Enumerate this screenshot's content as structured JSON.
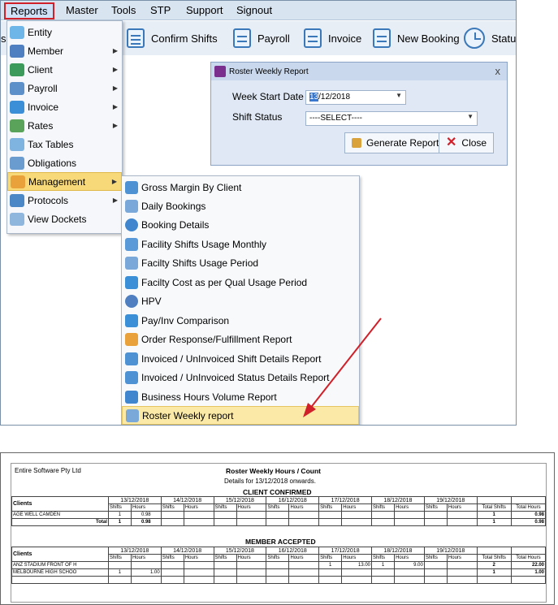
{
  "menubar": {
    "items": [
      "Reports",
      "Master",
      "Tools",
      "STP",
      "Support",
      "Signout"
    ]
  },
  "toolbar": {
    "partial_left": "s",
    "buttons": [
      "Confirm Shifts",
      "Payroll",
      "Invoice",
      "New Booking",
      "Status"
    ]
  },
  "dialog": {
    "title": "Roster Weekly Report",
    "close": "x",
    "week_start_label": "Week Start Date",
    "week_start_day": "13",
    "week_start_rest": "/12/2018",
    "shift_status_label": "Shift Status",
    "shift_status_value": "----SELECT----",
    "generate_label": "Generate Report",
    "close_label": "Close"
  },
  "menu": {
    "items": [
      {
        "label": "Entity",
        "icon": "entity-icon",
        "submenu": false
      },
      {
        "label": "Member",
        "icon": "member-icon",
        "submenu": true
      },
      {
        "label": "Client",
        "icon": "client-icon",
        "submenu": true
      },
      {
        "label": "Payroll",
        "icon": "payroll-icon",
        "submenu": true
      },
      {
        "label": "Invoice",
        "icon": "invoice-icon",
        "submenu": true
      },
      {
        "label": "Rates",
        "icon": "rates-icon",
        "submenu": true
      },
      {
        "label": "Tax Tables",
        "icon": "tax-tables-icon",
        "submenu": false
      },
      {
        "label": "Obligations",
        "icon": "obligations-icon",
        "submenu": false
      },
      {
        "label": "Management",
        "icon": "management-icon",
        "submenu": true
      },
      {
        "label": "Protocols",
        "icon": "protocols-icon",
        "submenu": true
      },
      {
        "label": "View Dockets",
        "icon": "dockets-icon",
        "submenu": false
      }
    ]
  },
  "submenu": {
    "items": [
      "Gross Margin By Client",
      "Daily Bookings",
      "Booking Details",
      "Facility Shifts Usage Monthly",
      "Facilty Shifts Usage Period",
      "Facilty Cost as per Qual Usage Period",
      "HPV",
      "Pay/Inv Comparison",
      "Order Response/Fulfillment Report",
      "Invoiced / UnInvoiced Shift Details Report",
      "Invoiced / UnInvoiced Status Details Report",
      "Business Hours Volume Report",
      "Roster Weekly report"
    ]
  },
  "colors": {
    "accent_red": "#d0202a",
    "menu_highlight": "#f7d97a",
    "menubar_bg": "#d9e4f1"
  },
  "report": {
    "company": "Entire Software Pty Ltd",
    "title": "Roster Weekly Hours / Count",
    "subtitle": "Details for 13/12/2018 onwards.",
    "section1": "CLIENT CONFIRMED",
    "section2": "MEMBER ACCEPTED",
    "clients_header": "Clients",
    "dates": [
      "13/12/2018",
      "14/12/2018",
      "15/12/2018",
      "16/12/2018",
      "17/12/2018",
      "18/12/2018",
      "19/12/2018"
    ],
    "shifts_label": "Shifts",
    "hours_label": "Hours",
    "total_shifts_label": "Total Shifts",
    "total_hours_label": "Total Hours",
    "total_label": "Total",
    "confirmed_row": {
      "client": "AGE WELL CAMDEN",
      "s1": "1",
      "h1": "0.98",
      "ts": "1",
      "th": "0.98"
    },
    "confirmed_total": {
      "s1": "1",
      "h1": "0.98",
      "ts": "1",
      "th": "0.98"
    },
    "accepted_rows": [
      {
        "client": "ANZ STADIUM FRONT OF H",
        "s5": "1",
        "h5": "13.00",
        "s6": "1",
        "h6": "9.00",
        "ts": "2",
        "th": "22.00"
      },
      {
        "client": "MELBOURNE HIGH SCHOO",
        "s1": "1",
        "h1": "1.00",
        "ts": "1",
        "th": "1.00"
      }
    ]
  }
}
